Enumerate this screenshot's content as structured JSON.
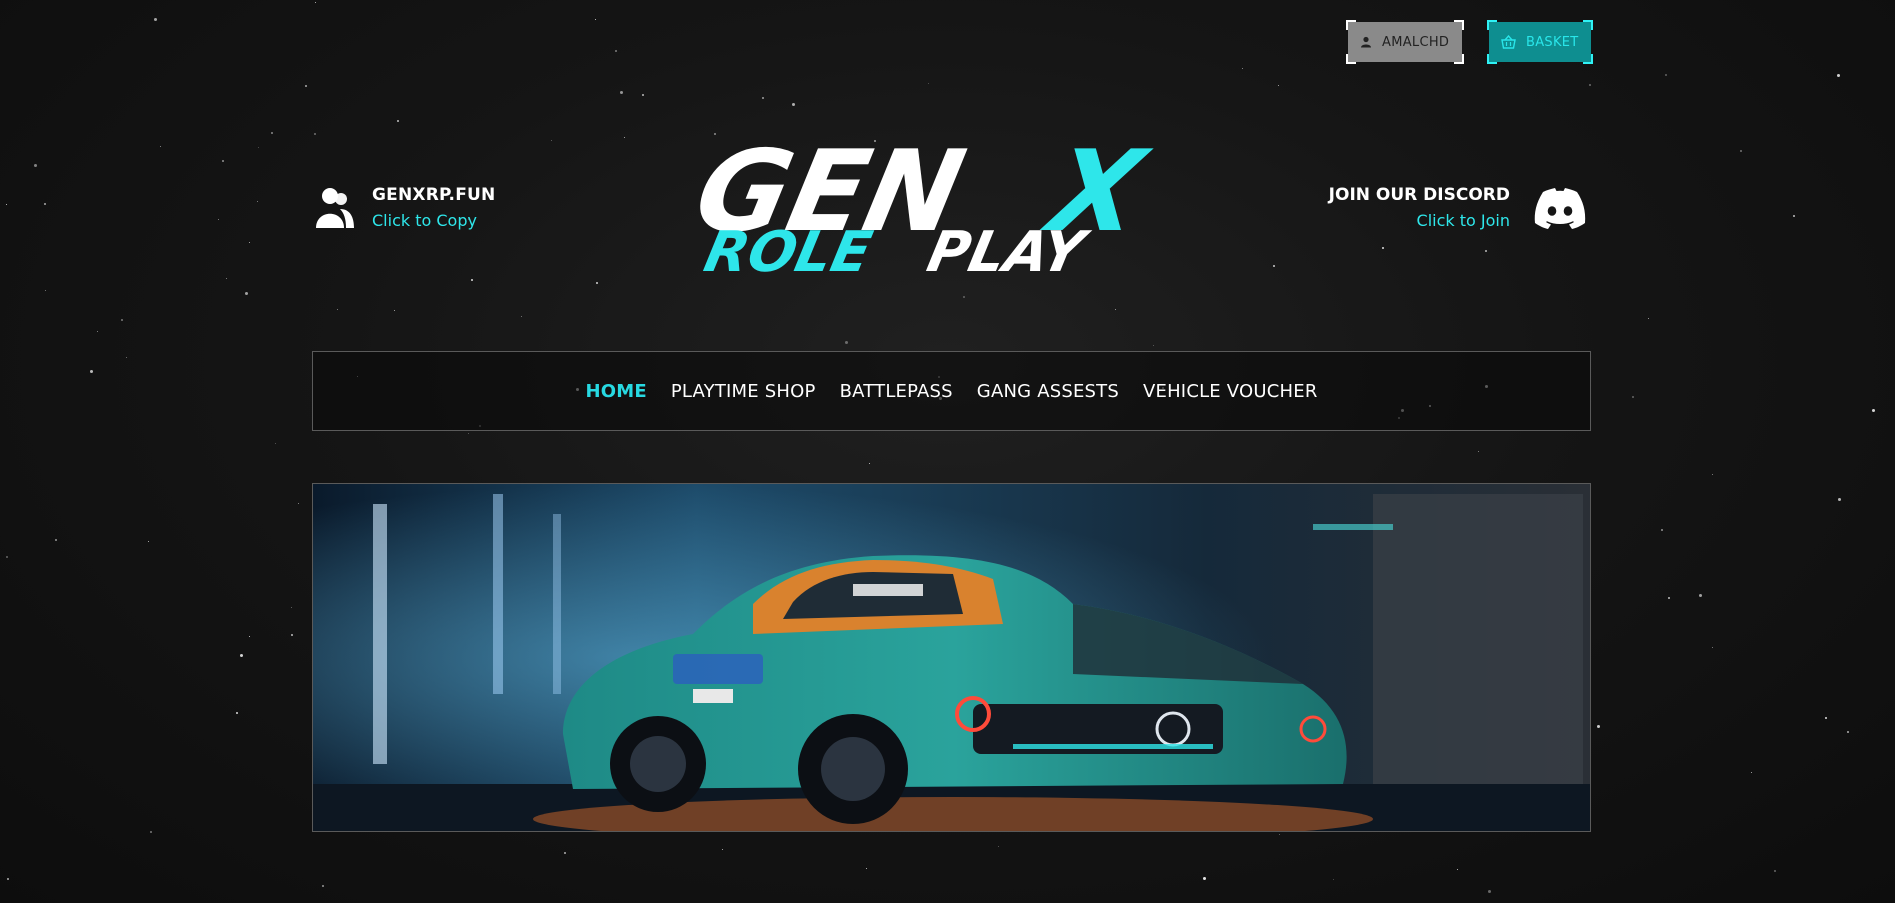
{
  "account": {
    "username": "AMALCHD",
    "basket_label": "BASKET"
  },
  "server": {
    "address": "GENXRP.FUN",
    "action": "Click to Copy"
  },
  "logo": {
    "line1_a": "GEN",
    "line1_b": "X",
    "line2_a": "ROLE",
    "line2_b": "PLAY"
  },
  "discord": {
    "title": "JOIN OUR DISCORD",
    "action": "Click to Join"
  },
  "nav": {
    "items": [
      {
        "label": "HOME",
        "active": true
      },
      {
        "label": "PLAYTIME SHOP",
        "active": false
      },
      {
        "label": "BATTLEPASS",
        "active": false
      },
      {
        "label": "GANG ASSESTS",
        "active": false
      },
      {
        "label": "VEHICLE VOUCHER",
        "active": false
      }
    ]
  },
  "banner": {
    "image": "neon-livery-sports-car"
  },
  "colors": {
    "accent": "#2ee6ea",
    "background": "#151515",
    "user_button": "#8a8a8a",
    "basket_button": "#0e8e90"
  },
  "icons": [
    "user-icon",
    "basket-icon",
    "users-icon",
    "discord-icon"
  ]
}
